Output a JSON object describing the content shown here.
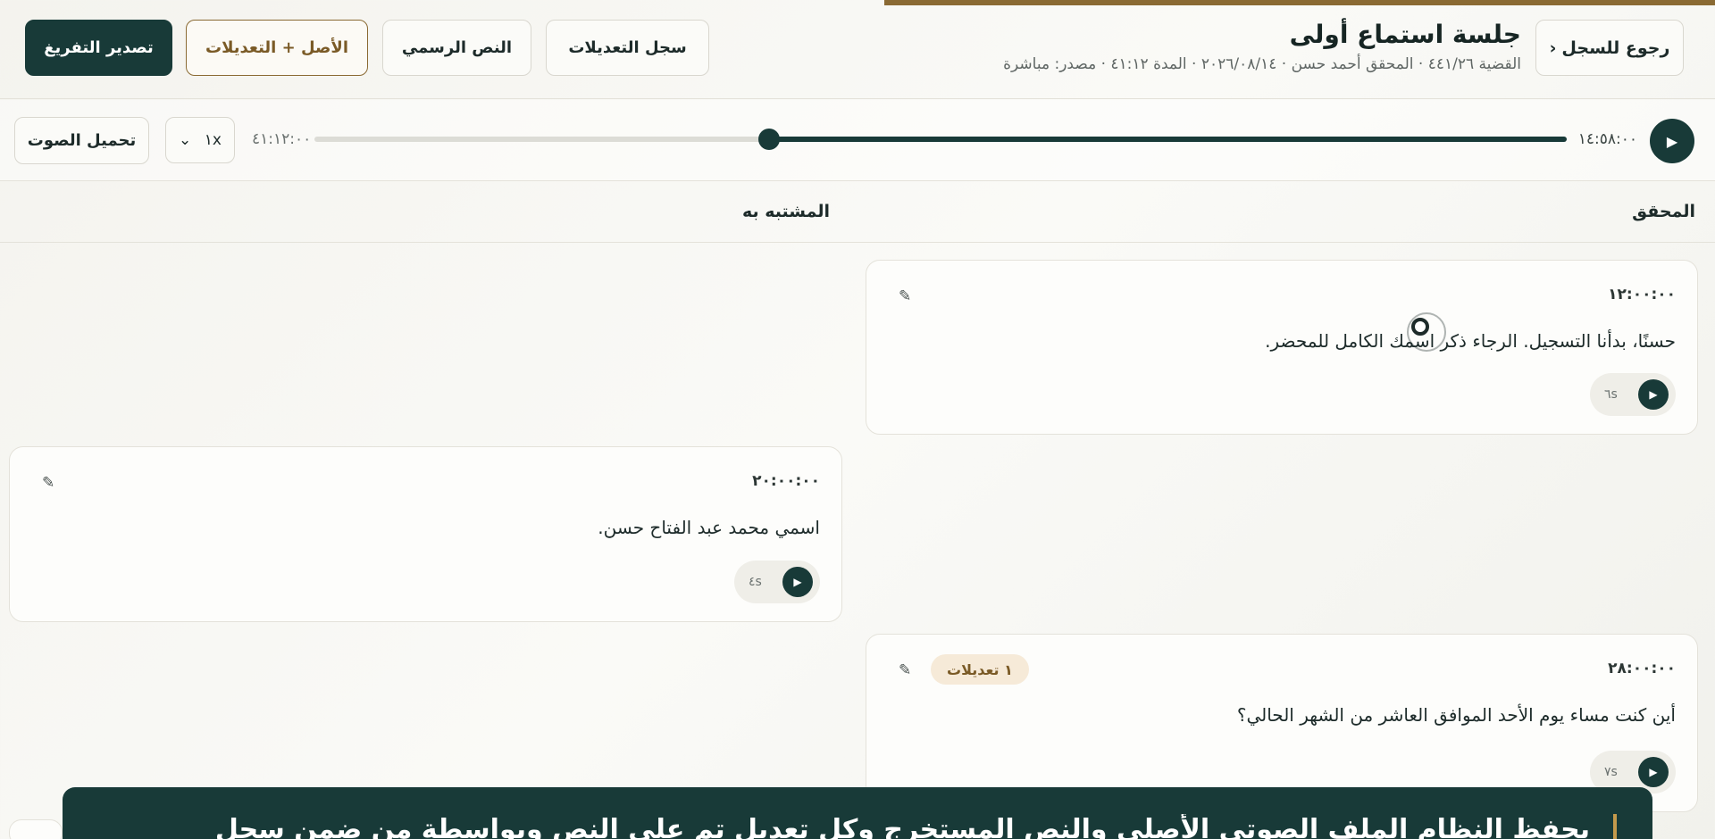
{
  "header": {
    "back_label": "رجوع للسجل",
    "back_icon": "‹",
    "title": "جلسة استماع أولى",
    "meta": "القضية ٤٤١/٢٦ · المحقق أحمد حسن · ٢٠٢٦/٠٨/١٤ · المدة ٤١:١٢ · مصدر: مباشرة",
    "buttons": {
      "log": "سجل التعديلات",
      "official": "النص الرسمي",
      "original_mod": "الأصل + التعديلات",
      "export": "تصدير التفريغ"
    }
  },
  "player": {
    "current_time": "١٤:٥٨:٠٠",
    "total_time": "٤١:١٢:٠٠",
    "progress": 0.363,
    "speed": "١x",
    "download_label": "تحميل الصوت"
  },
  "columns": {
    "investigator": "المحقق",
    "suspect": "المشتبه به"
  },
  "cards": [
    {
      "time": "١٢:٠٠:٠٠",
      "text": "حسنًا، بدأنا التسجيل. الرجاء ذكر اسمك الكامل للمحضر.",
      "duration": "٦s",
      "edit_icon": "✎"
    },
    {
      "time": "٢٠:٠٠:٠٠",
      "text": "اسمي محمد عبد الفتاح حسن.",
      "duration": "٤s",
      "edit_icon": "✎"
    },
    {
      "time": "٢٨:٠٠:٠٠",
      "text": "أين كنت مساء يوم الأحد الموافق العاشر من الشهر الحالي؟",
      "duration": "٧s",
      "edit_icon": "✎",
      "badge": "١ تعديلات"
    }
  ],
  "banner": {
    "text": "يحفظ النظام الملف الصوتي الأصلي والنص المستخرج وكل تعديل تم على النص وبواسطة من ضمن سجل"
  },
  "colors": {
    "primary": "#183a38",
    "accent": "#8a6a33",
    "badge_bg": "#f6ead8"
  }
}
